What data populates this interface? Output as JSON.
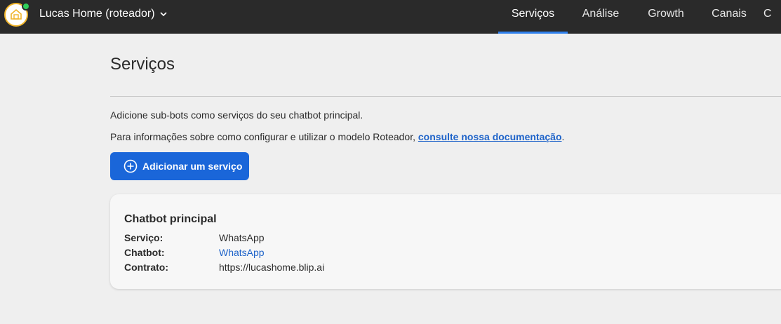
{
  "header": {
    "bot_name": "Lucas Home (roteador)",
    "tabs": [
      {
        "label": "Serviços",
        "active": true
      },
      {
        "label": "Análise",
        "active": false
      },
      {
        "label": "Growth",
        "active": false
      },
      {
        "label": "Canais",
        "active": false
      },
      {
        "label": "C",
        "active": false
      }
    ]
  },
  "main": {
    "title": "Serviços",
    "description": "Adicione sub-bots como serviços do seu chatbot principal.",
    "doc_prefix": "Para informações sobre como configurar e utilizar o modelo Roteador, ",
    "doc_link": "consulte nossa documentação",
    "doc_suffix": ".",
    "add_button": "Adicionar um serviço"
  },
  "card": {
    "title": "Chatbot principal",
    "rows": [
      {
        "key": "Serviço:",
        "value": "WhatsApp"
      },
      {
        "key": "Chatbot:",
        "value": "WhatsApp"
      },
      {
        "key": "Contrato:",
        "value": "https://lucashome.blip.ai"
      }
    ]
  },
  "colors": {
    "topbar": "#2a2a2a",
    "accent": "#1a66d9",
    "link": "#1e63c9",
    "status_online": "#2fcf5a"
  }
}
